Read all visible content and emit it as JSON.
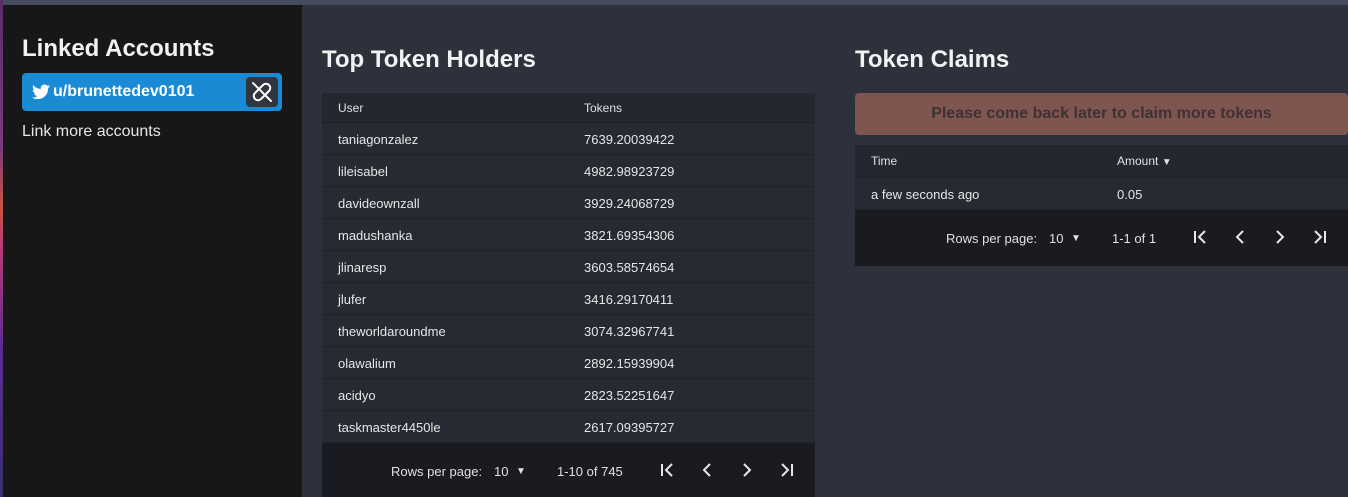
{
  "sidebar": {
    "title": "Linked Accounts",
    "account": {
      "name": "u/brunettedev0101",
      "icon": "twitter-icon",
      "unlink_icon": "unlink-icon"
    },
    "link_more": "Link more accounts"
  },
  "holders": {
    "title": "Top Token Holders",
    "columns": [
      "User",
      "Tokens"
    ],
    "rows": [
      [
        "taniagonzalez",
        "7639.20039422"
      ],
      [
        "lileisabel",
        "4982.98923729"
      ],
      [
        "davideownzall",
        "3929.24068729"
      ],
      [
        "madushanka",
        "3821.69354306"
      ],
      [
        "jlinaresp",
        "3603.58574654"
      ],
      [
        "jlufer",
        "3416.29170411"
      ],
      [
        "theworldaroundme",
        "3074.32967741"
      ],
      [
        "olawalium",
        "2892.15939904"
      ],
      [
        "acidyo",
        "2823.52251647"
      ],
      [
        "taskmaster4450le",
        "2617.09395727"
      ]
    ],
    "pager": {
      "rows_label": "Rows per page:",
      "rows_value": "10",
      "range": "1-10 of 745"
    }
  },
  "claims": {
    "title": "Token Claims",
    "banner": "Please come back later to claim more tokens",
    "columns": [
      "Time",
      "Amount"
    ],
    "sort_indicator": "▼",
    "rows": [
      [
        "a few seconds ago",
        "0.05"
      ]
    ],
    "pager": {
      "rows_label": "Rows per page:",
      "rows_value": "10",
      "range": "1-1 of 1"
    }
  },
  "colors": {
    "accent": "#1a8ad4",
    "banner": "#7f554f",
    "sidebar_bg": "#171717",
    "page_bg": "#2c313c"
  }
}
